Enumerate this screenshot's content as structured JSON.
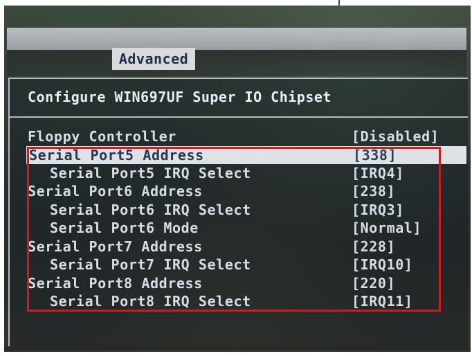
{
  "screen": {
    "tab_active": "Advanced"
  },
  "panel": {
    "title": "Configure WIN697UF Super IO Chipset"
  },
  "settings": [
    {
      "label": "Floppy Controller",
      "value": "[Disabled]"
    },
    {
      "label": "Serial Port5 Address",
      "value": "[338]"
    },
    {
      "label": "Serial Port5 IRQ Select",
      "value": "[IRQ4]"
    },
    {
      "label": "Serial Port6 Address",
      "value": "[238]"
    },
    {
      "label": "Serial Port6 IRQ Select",
      "value": "[IRQ3]"
    },
    {
      "label": "Serial Port6 Mode",
      "value": "[Normal]"
    },
    {
      "label": "Serial Port7 Address",
      "value": "[228]"
    },
    {
      "label": "Serial Port7 IRQ Select",
      "value": "[IRQ10]"
    },
    {
      "label": "Serial Port8 Address",
      "value": "[220]"
    },
    {
      "label": "Serial Port8 IRQ Select",
      "value": "[IRQ11]"
    }
  ],
  "colors": {
    "selection_bg": "#dfe2e5",
    "annotation_box": "#d11a1a",
    "text": "#d6dde6"
  }
}
